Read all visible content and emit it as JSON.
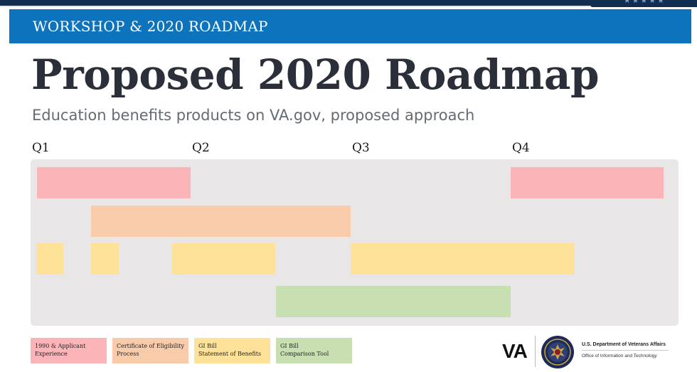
{
  "colors": {
    "banner": "#0e73bd",
    "navy": "#112e51",
    "timeline_bg": "#e8e6e7",
    "pink": "#fbb5b8",
    "orange": "#f8cbaa",
    "yellow": "#fee29a",
    "green": "#c7dfb1"
  },
  "header": {
    "stars": "★★★★★",
    "banner_title": "WORKSHOP & 2020 ROADMAP"
  },
  "main": {
    "title": "Proposed 2020 Roadmap",
    "subtitle": "Education benefits products on VA.gov, proposed approach"
  },
  "timeline": {
    "quarters": [
      "Q1",
      "Q2",
      "Q3",
      "Q4"
    ],
    "bars": [
      {
        "product": "1990 & Applicant Experience",
        "color": "#fbb5b8",
        "start_quarter": 1.0,
        "end_quarter": 1.95
      },
      {
        "product": "1990 & Applicant Experience",
        "color": "#fbb5b8",
        "start_quarter": 4.0,
        "end_quarter": 4.95
      },
      {
        "product": "Certificate of Eligibility Process",
        "color": "#f8cbaa",
        "start_quarter": 1.34,
        "end_quarter": 2.95
      },
      {
        "product": "GI Bill Statement of Benefits",
        "color": "#fee29a",
        "start_quarter": 1.0,
        "end_quarter": 1.17
      },
      {
        "product": "GI Bill Statement of Benefits",
        "color": "#fee29a",
        "start_quarter": 1.34,
        "end_quarter": 1.51
      },
      {
        "product": "GI Bill Statement of Benefits",
        "color": "#fee29a",
        "start_quarter": 1.85,
        "end_quarter": 2.49
      },
      {
        "product": "GI Bill Statement of Benefits",
        "color": "#fee29a",
        "start_quarter": 2.96,
        "end_quarter": 4.36
      },
      {
        "product": "GI Bill Comparison Tool",
        "color": "#c7dfb1",
        "start_quarter": 2.5,
        "end_quarter": 3.96
      }
    ]
  },
  "legend": [
    {
      "line1": "1990 & Applicant",
      "line2": "Experience",
      "color": "#fbb5b8"
    },
    {
      "line1": "Certificate of Eligibility",
      "line2": "Process",
      "color": "#f8cbaa"
    },
    {
      "line1": "GI Bill",
      "line2": "Statement of Benefits",
      "color": "#fee29a"
    },
    {
      "line1": "GI Bill",
      "line2": "Comparison Tool",
      "color": "#c7dfb1"
    }
  ],
  "footer": {
    "logo_text": "VA",
    "seal_icon": "va-seal-icon",
    "dept_name": "U.S. Department of Veterans Affairs",
    "office_name": "Office of Information and Technology"
  }
}
